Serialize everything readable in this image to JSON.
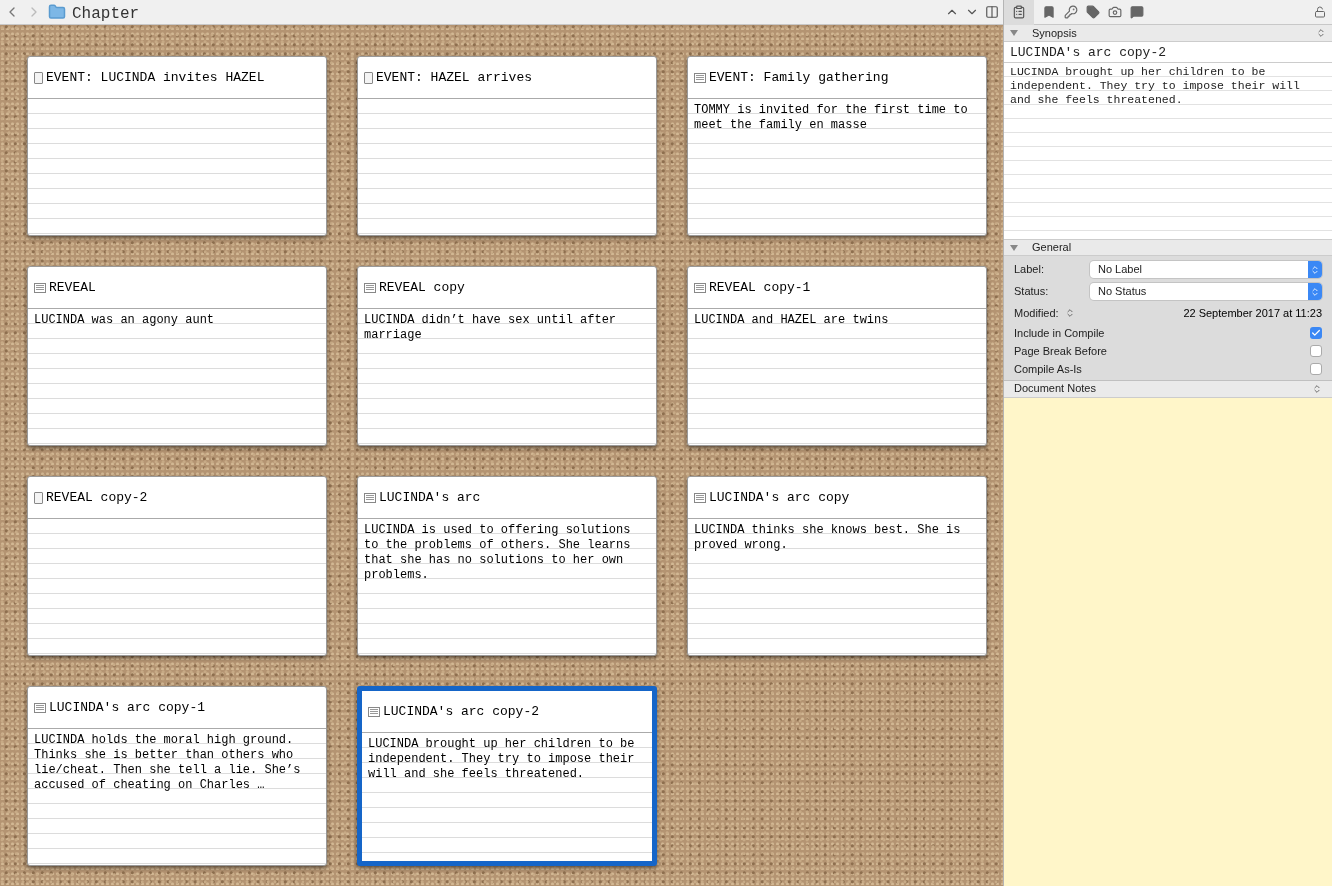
{
  "toolbar": {
    "title": "Chapter"
  },
  "cards": [
    {
      "title": "EVENT: LUCINDA invites HAZEL",
      "kind": "blank",
      "selected": false
    },
    {
      "title": "EVENT: HAZEL arrives",
      "kind": "blank",
      "selected": false
    },
    {
      "title": "EVENT: Family gathering",
      "kind": "text",
      "synopsis": "TOMMY is invited for the first time to meet the family en masse",
      "selected": false
    },
    {
      "title": "REVEAL",
      "kind": "text",
      "synopsis": "LUCINDA was an agony aunt",
      "selected": false
    },
    {
      "title": "REVEAL copy",
      "kind": "text",
      "synopsis": "LUCINDA didn’t have sex until after marriage",
      "selected": false
    },
    {
      "title": "REVEAL copy-1",
      "kind": "text",
      "synopsis": "LUCINDA and HAZEL are twins",
      "selected": false
    },
    {
      "title": "REVEAL copy-2",
      "kind": "blank",
      "selected": false
    },
    {
      "title": "LUCINDA's arc",
      "kind": "text",
      "synopsis": "LUCINDA is used to offering solutions to the problems of others. She learns that she has no solutions to her own problems.",
      "selected": false
    },
    {
      "title": "LUCINDA's arc copy",
      "kind": "text",
      "synopsis": "LUCINDA thinks she knows best. She is proved wrong.",
      "selected": false
    },
    {
      "title": "LUCINDA's arc copy-1",
      "kind": "text",
      "synopsis": "LUCINDA holds the moral high ground. Thinks she is better than others who lie/cheat. Then she tell a lie. She’s accused of cheating on Charles …",
      "selected": false
    },
    {
      "title": "LUCINDA's arc copy-2",
      "kind": "text",
      "synopsis": "LUCINDA brought up her children to be independent. They try to impose their will and she feels threatened.",
      "selected": true
    }
  ],
  "inspector": {
    "synopsis": {
      "heading": "Synopsis",
      "title": "LUCINDA's arc copy-2",
      "text": "LUCINDA brought up her children to be independent. They try to impose their will and she feels threatened."
    },
    "general": {
      "heading": "General",
      "label_caption": "Label:",
      "label_value": "No Label",
      "status_caption": "Status:",
      "status_value": "No Status",
      "modified_caption": "Modified:",
      "modified_value": "22 September 2017 at 11:23",
      "options": [
        {
          "label": "Include in Compile",
          "checked": true
        },
        {
          "label": "Page Break Before",
          "checked": false
        },
        {
          "label": "Compile As-Is",
          "checked": false
        }
      ]
    },
    "notes": {
      "heading": "Document Notes"
    }
  }
}
